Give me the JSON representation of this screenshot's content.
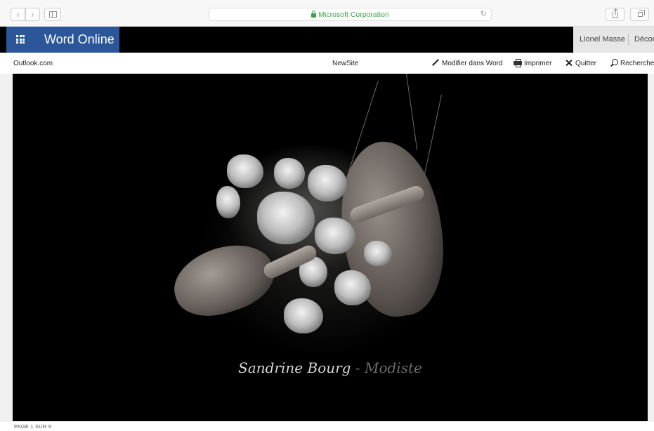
{
  "browser": {
    "address": "Microsoft Corporation",
    "back_glyph": "‹",
    "forward_glyph": "›",
    "reload_glyph": "↻"
  },
  "suite_bar": {
    "app_name": "Word Online",
    "user_name": "Lionel Masse",
    "signout_label": "Déconnexion",
    "brand_color": "#2b579a"
  },
  "command_bar": {
    "outlook_link": "Outlook.com",
    "document_name": "NewSite",
    "edit_label": "Modifier dans Word",
    "print_label": "Imprimer",
    "quit_label": "Quitter",
    "search_label": "Rechercher"
  },
  "document": {
    "caption_name": "Sandrine Bourg",
    "caption_dash": "-",
    "caption_role": "Modiste"
  },
  "status": {
    "page_indicator": "PAGE 1 SUR 9"
  },
  "icons": [
    "lock-icon",
    "reload-icon",
    "sidebar-icon",
    "share-icon",
    "tabs-icon",
    "waffle-icon",
    "pencil-icon",
    "printer-icon",
    "close-icon",
    "search-icon"
  ]
}
